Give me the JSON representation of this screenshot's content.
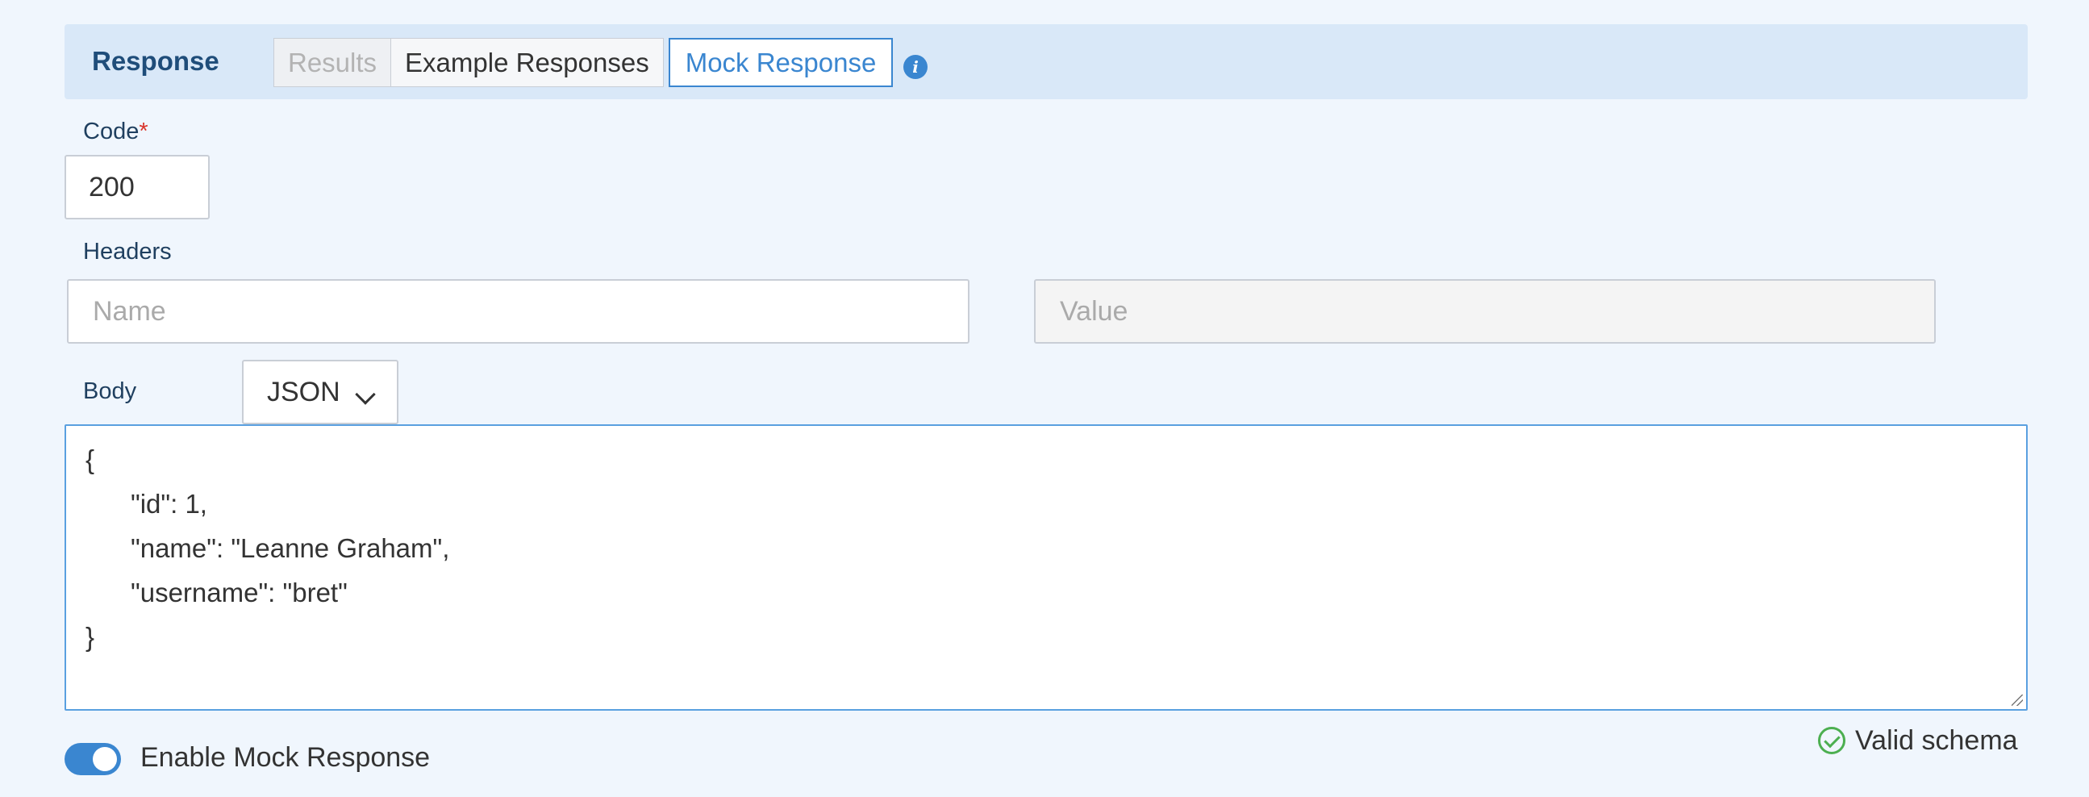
{
  "response": {
    "title": "Response",
    "tabs": [
      {
        "label": "Results",
        "state": "disabled"
      },
      {
        "label": "Example Responses",
        "state": "normal"
      },
      {
        "label": "Mock Response",
        "state": "active"
      }
    ],
    "info_icon": "info-icon"
  },
  "code": {
    "label": "Code",
    "required_mark": "*",
    "value": "200"
  },
  "headers": {
    "label": "Headers",
    "name_placeholder": "Name",
    "value_placeholder": "Value"
  },
  "body": {
    "label": "Body",
    "format": "JSON",
    "lines": [
      "{",
      "\"id\": 1,",
      "\"name\": \"Leanne Graham\",",
      "\"username\": \"bret\"",
      "}"
    ]
  },
  "mock": {
    "toggle_label": "Enable Mock Response",
    "enabled": true
  },
  "validation": {
    "text": "Valid schema",
    "icon": "check-circle-icon"
  },
  "colors": {
    "accent": "#3a86d0",
    "header_bg": "#d9e8f8",
    "page_bg": "#f0f6fd",
    "valid": "#4caf50"
  }
}
